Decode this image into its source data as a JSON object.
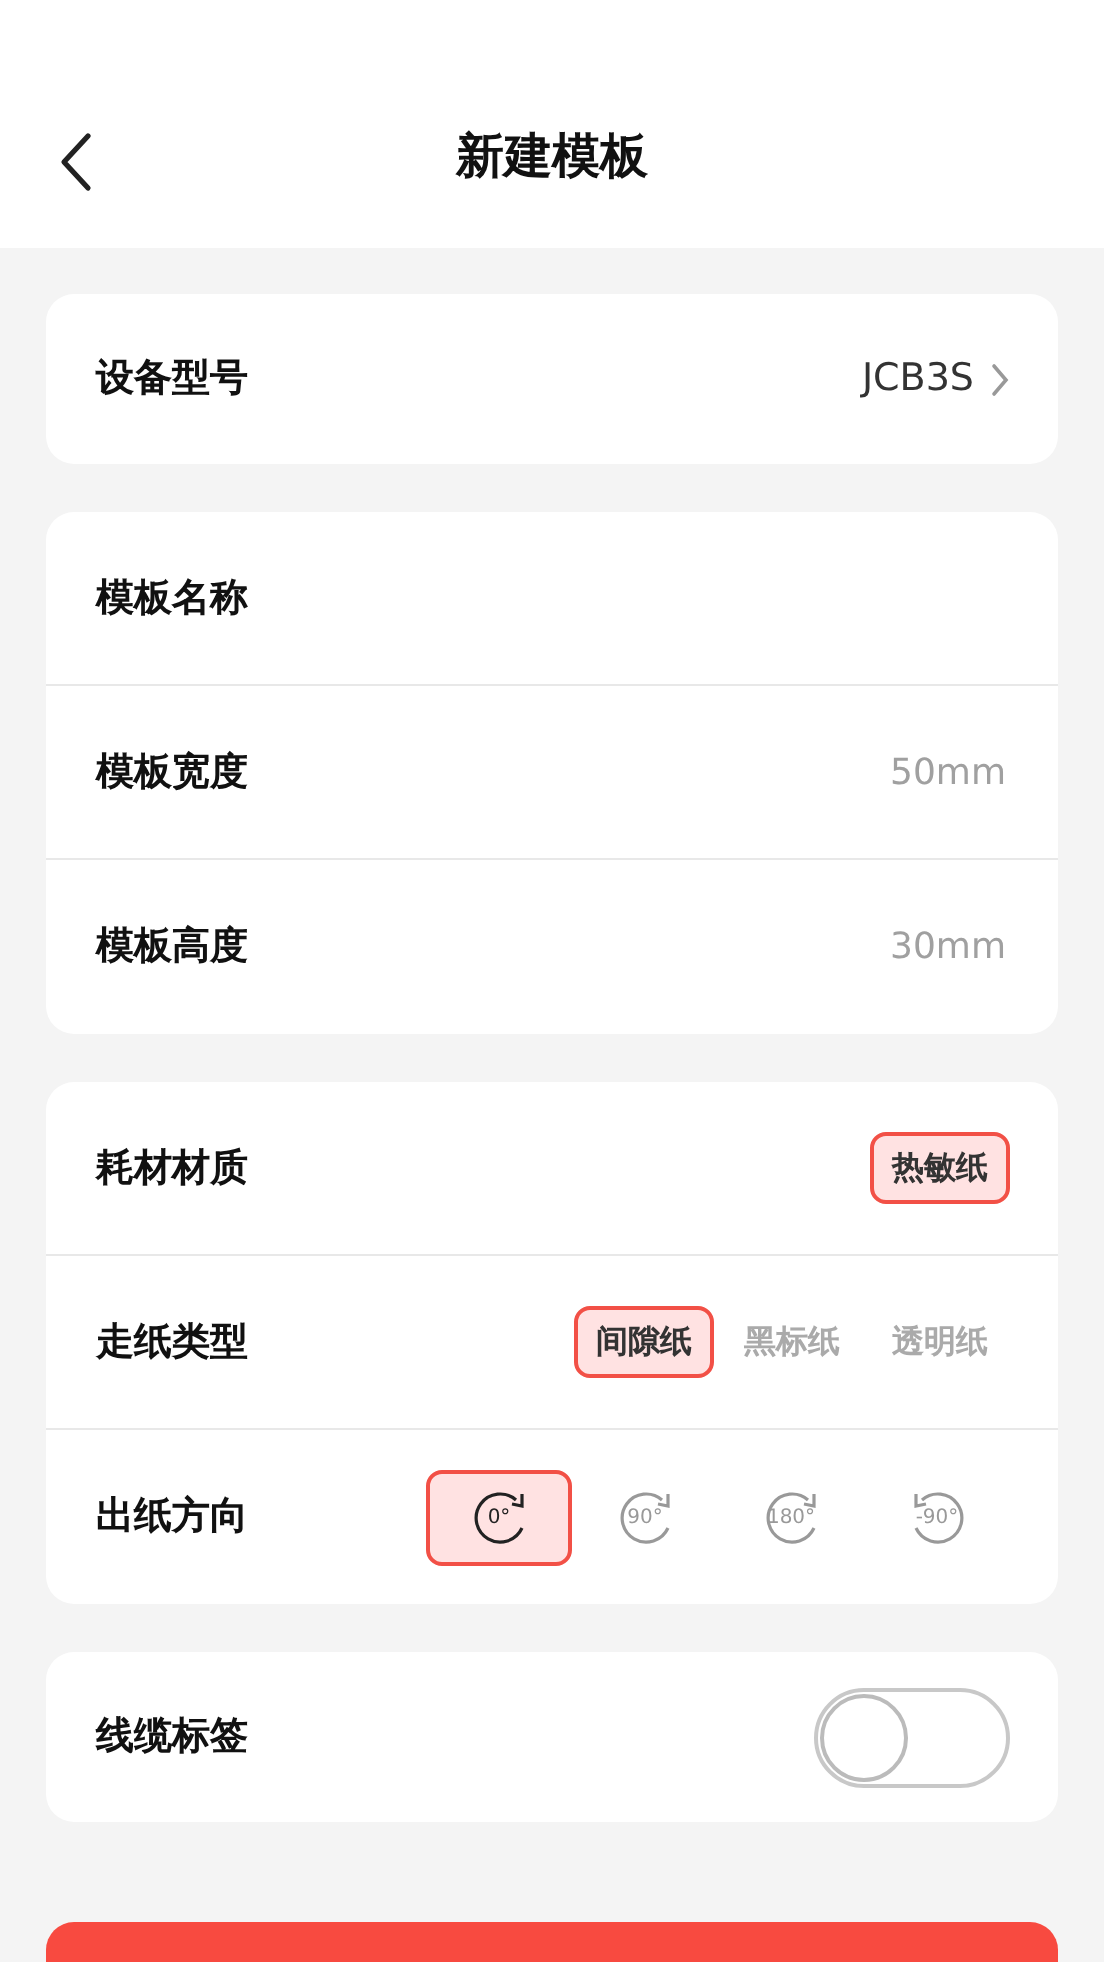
{
  "header": {
    "title": "新建模板"
  },
  "device": {
    "label": "设备型号",
    "value": "JCB3S"
  },
  "template_fields": [
    {
      "label": "模板名称"
    },
    {
      "label": "模板宽度",
      "placeholder": "50mm"
    },
    {
      "label": "模板高度",
      "placeholder": "30mm"
    }
  ],
  "material": {
    "label": "耗材材质",
    "options": [
      {
        "label": "热敏纸",
        "selected": true
      }
    ]
  },
  "paper_type": {
    "label": "走纸类型",
    "options": [
      {
        "label": "间隙纸",
        "selected": true
      },
      {
        "label": "黑标纸",
        "selected": false
      },
      {
        "label": "透明纸",
        "selected": false
      }
    ]
  },
  "direction": {
    "label": "出纸方向",
    "options": [
      {
        "label": "0°",
        "selected": true
      },
      {
        "label": "90°",
        "selected": false
      },
      {
        "label": "180°",
        "selected": false
      },
      {
        "label": "-90°",
        "selected": false
      }
    ]
  },
  "cable_label": {
    "label": "线缆标签",
    "on": false
  }
}
